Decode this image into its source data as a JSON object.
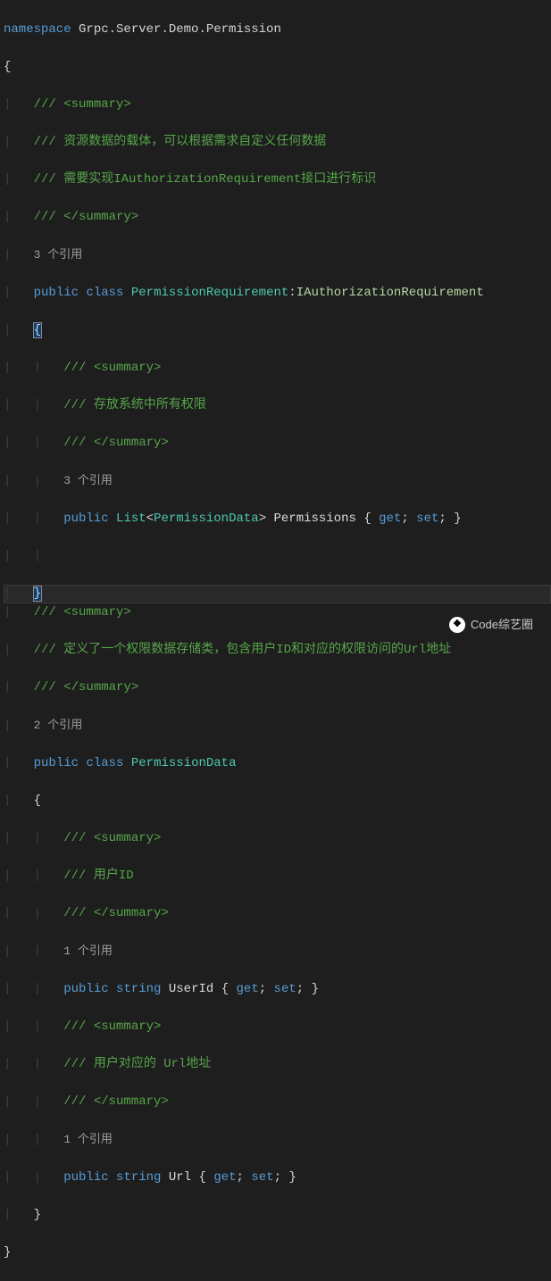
{
  "code": {
    "ns_kw": "namespace",
    "ns_name": " Grpc.Server.Demo.Permission",
    "brace_open": "{",
    "brace_close": "}",
    "sum_open": "/// <summary>",
    "sum_close": "/// </summary>",
    "c1_l1": "/// 资源数据的载体，可以根据需求自定义任何数据",
    "c1_l2": "/// 需要实现IAuthorizationRequirement接口进行标识",
    "refs3": "3 个引用",
    "refs2": "2 个引用",
    "refs1": "1 个引用",
    "public": "public",
    "class": "class",
    "string": "string",
    "get": "get",
    "set": "set",
    "cls1": "PermissionRequirement",
    "iface1": "IAuthorizationRequirement",
    "c2": "/// 存放系统中所有权限",
    "list": "List",
    "gen1": "PermissionData",
    "prop1": "Permissions",
    "c3": "/// 定义了一个权限数据存储类，包含用户ID和对应的权限访问的Url地址",
    "cls2": "PermissionData",
    "c4": "/// 用户ID",
    "prop2": "UserId",
    "c5": "/// 用户对应的 Url地址",
    "prop3": "Url"
  },
  "watermark": {
    "icon": "❖",
    "text": "Code综艺圈"
  }
}
